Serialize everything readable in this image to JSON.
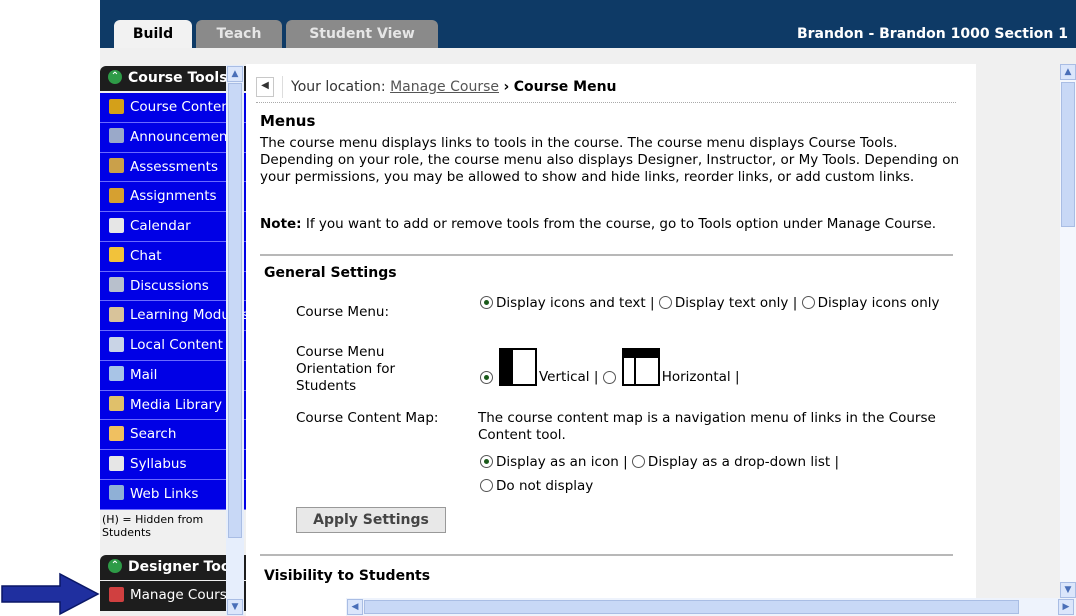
{
  "tabs": {
    "build": "Build",
    "teach": "Teach",
    "student_view": "Student View"
  },
  "course_name": "Brandon - Brandon 1000 Section 1",
  "sidebar": {
    "course_tools_title": "Course Tools",
    "items": [
      {
        "label": "Course Content",
        "icon": "home-icon",
        "color": "#d4a019"
      },
      {
        "label": "Announcements",
        "icon": "megaphone-icon",
        "color": "#9aa9c9"
      },
      {
        "label": "Assessments",
        "icon": "assessment-icon",
        "color": "#caa04a"
      },
      {
        "label": "Assignments",
        "icon": "assignment-icon",
        "color": "#d6a030"
      },
      {
        "label": "Calendar",
        "icon": "calendar-icon",
        "color": "#e6e6e6"
      },
      {
        "label": "Chat",
        "icon": "chat-icon",
        "color": "#f2c23a"
      },
      {
        "label": "Discussions",
        "icon": "pin-icon",
        "color": "#b8c0cc"
      },
      {
        "label": "Learning Modules",
        "icon": "module-icon",
        "color": "#d8c39a"
      },
      {
        "label": "Local Content",
        "icon": "disc-icon",
        "color": "#c9d4e6"
      },
      {
        "label": "Mail",
        "icon": "mail-icon",
        "color": "#a8c4e6"
      },
      {
        "label": "Media Library",
        "icon": "media-icon",
        "color": "#e0c06a"
      },
      {
        "label": "Search",
        "icon": "search-icon",
        "color": "#f0c060"
      },
      {
        "label": "Syllabus",
        "icon": "syllabus-icon",
        "color": "#e6e6e6"
      },
      {
        "label": "Web Links",
        "icon": "globe-icon",
        "color": "#8fb0d6"
      }
    ],
    "hidden_note": "(H) = Hidden from Students",
    "designer_tools_title": "Designer Tools",
    "designer_items": [
      {
        "label": "Manage Course",
        "icon": "manage-course-icon",
        "color": "#d04040"
      }
    ]
  },
  "breadcrumb": {
    "prefix": "Your location:",
    "link": "Manage Course",
    "separator": "›",
    "current": "Course Menu"
  },
  "menus": {
    "title": "Menus",
    "description": "The course menu displays links to tools in the course. The course menu displays Course Tools. Depending on your role, the course menu also displays Designer, Instructor, or My Tools. Depending on your permissions, you may be allowed to show and hide links, reorder links, or add custom links.",
    "note_label": "Note:",
    "note_text": " If you want to add or remove tools from the course, go to Tools option under Manage Course."
  },
  "general_settings": {
    "title": "General Settings",
    "course_menu_label": "Course Menu:",
    "course_menu_options": [
      "Display icons and text",
      "Display text only",
      "Display icons only"
    ],
    "course_menu_selected": 0,
    "orientation_label": "Course Menu Orientation for Students",
    "orientation_options": [
      "Vertical",
      "Horizontal"
    ],
    "orientation_selected": 0,
    "content_map_label": "Course Content Map:",
    "content_map_desc": "The course content map is a navigation menu of links in the Course Content tool.",
    "content_map_options": [
      "Display as an icon",
      "Display as a drop-down list",
      "Do not display"
    ],
    "content_map_selected": 0,
    "pipe": "|",
    "apply_button": "Apply Settings"
  },
  "visibility_title": "Visibility to Students",
  "colors": {
    "accent_blue": "#0000e6",
    "topbar": "#0e3a66",
    "arrow": "#1f2f9f"
  }
}
